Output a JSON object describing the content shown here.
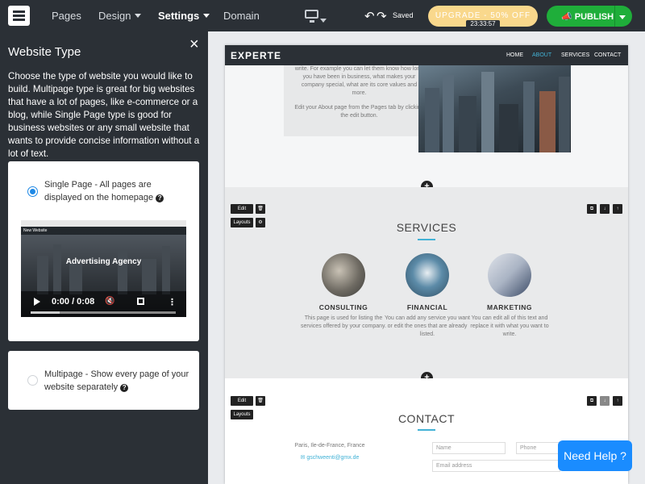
{
  "topbar": {
    "nav": [
      {
        "label": "Pages"
      },
      {
        "label": "Design"
      },
      {
        "label": "Settings"
      },
      {
        "label": "Domain"
      }
    ],
    "saved": "Saved",
    "upgrade": "UPGRADE - 50% OFF",
    "timer": "23:33:57",
    "publish": "PUBLISH"
  },
  "panel": {
    "title": "Website Type",
    "close": "×",
    "description": "Choose the type of website you would like to build. Multipage type is great for big websites that have a lot of pages, like e-commerce or a blog, while Single Page type is good for business websites or any small website that wants to provide concise information without a lot of text.",
    "options": [
      {
        "label": "Single Page - All pages are displayed on the homepage",
        "selected": true
      },
      {
        "label": "Multipage - Show every page of your website separately",
        "selected": false
      }
    ],
    "video": {
      "site_name": "New Website",
      "headline": "Advertising Agency",
      "time": "0:00 / 0:08",
      "progress": 0.2
    }
  },
  "preview": {
    "brand": "EXPERTE",
    "nav_links": [
      "HOME",
      "ABOUT",
      "SERVICES",
      "CONTACT"
    ],
    "active_link": "ABOUT",
    "about_text_1": "write. For example you can let them know how long you have been in business, what makes your company special, what are its core values and more.",
    "about_text_2": "Edit your About page from the Pages tab by clicking the edit button.",
    "edit_label": "Edit",
    "layouts_label": "Layouts",
    "services_title": "SERVICES",
    "services": [
      {
        "name": "CONSULTING",
        "desc": "This page is used for listing the services offered by your company."
      },
      {
        "name": "FINANCIAL",
        "desc": "You can add any service you want or edit the ones that are already listed."
      },
      {
        "name": "MARKETING",
        "desc": "You can edit all of this text and replace it with what you want to write."
      }
    ],
    "contact_title": "CONTACT",
    "contact_address": "Paris, Ile-de-France, France",
    "contact_email": "gschweenti@gmx.de",
    "fields": {
      "name": "Name",
      "phone": "Phone",
      "email": "Email address"
    }
  },
  "help": "Need Help ?",
  "colors": {
    "accent": "#1e88e5",
    "publish": "#1fae3a",
    "upgrade": "#f9d88c",
    "topbar": "#2b3036",
    "link": "#42b2d6"
  }
}
